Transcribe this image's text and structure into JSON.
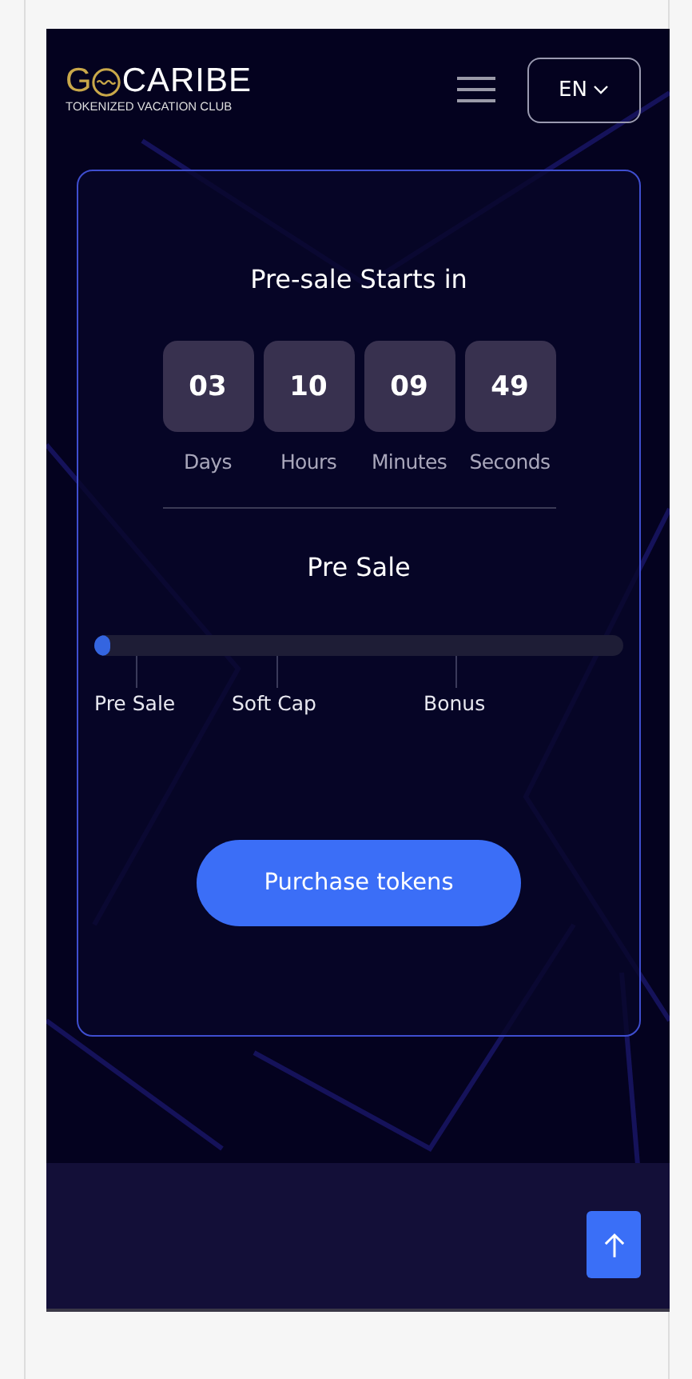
{
  "header": {
    "logo": {
      "lead": "G",
      "name": "CARIBE",
      "tagline": "TOKENIZED VACATION CLUB"
    },
    "language": "EN"
  },
  "countdown": {
    "title": "Pre-sale Starts in",
    "units": [
      {
        "value": "03",
        "label": "Days"
      },
      {
        "value": "10",
        "label": "Hours"
      },
      {
        "value": "09",
        "label": "Minutes"
      },
      {
        "value": "49",
        "label": "Seconds"
      }
    ]
  },
  "sale": {
    "title": "Pre Sale",
    "level": 0.02,
    "milestones": [
      "Pre Sale",
      "Soft Cap",
      "Bonus"
    ]
  },
  "purchase_button": "Purchase tokens"
}
